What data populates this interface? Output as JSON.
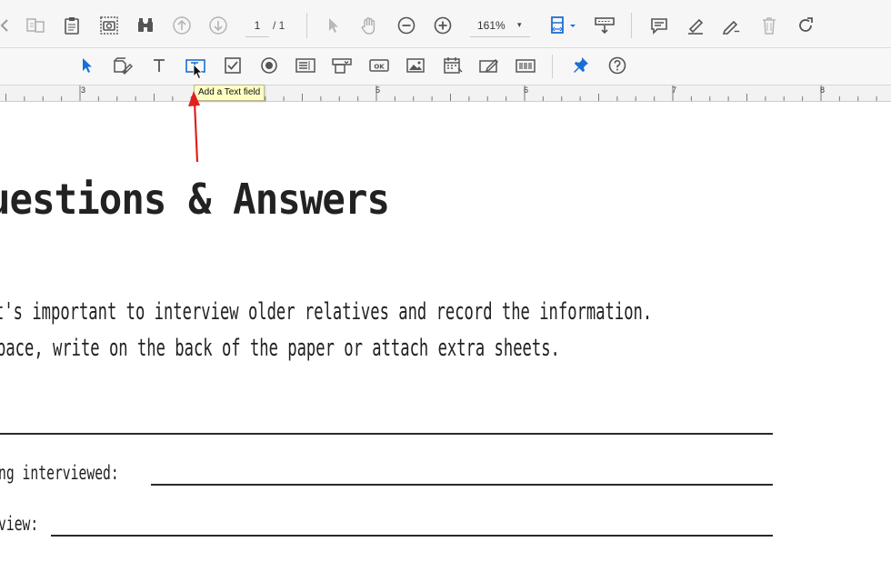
{
  "toolbar": {
    "page_current": "1",
    "page_total": "/ 1",
    "zoom": "161%",
    "zoom_caret": "▾"
  },
  "form_toolbar": {
    "tooltip": "Add a Text field"
  },
  "ruler": {
    "labels": [
      "3",
      "5",
      "6",
      "7",
      "8"
    ]
  },
  "document": {
    "title": "uestions & Answers",
    "paragraph_line1": "t's important to interview older relatives and record the information.",
    "paragraph_line2": "pace, write on the back of the paper or attach extra sheets.",
    "field2_label": "ng interviewed:",
    "field3_label": "view:"
  },
  "colors": {
    "accent_blue": "#1a6fd6",
    "annotation_arrow": "#e02020",
    "tooltip_bg": "#ffffc4"
  }
}
